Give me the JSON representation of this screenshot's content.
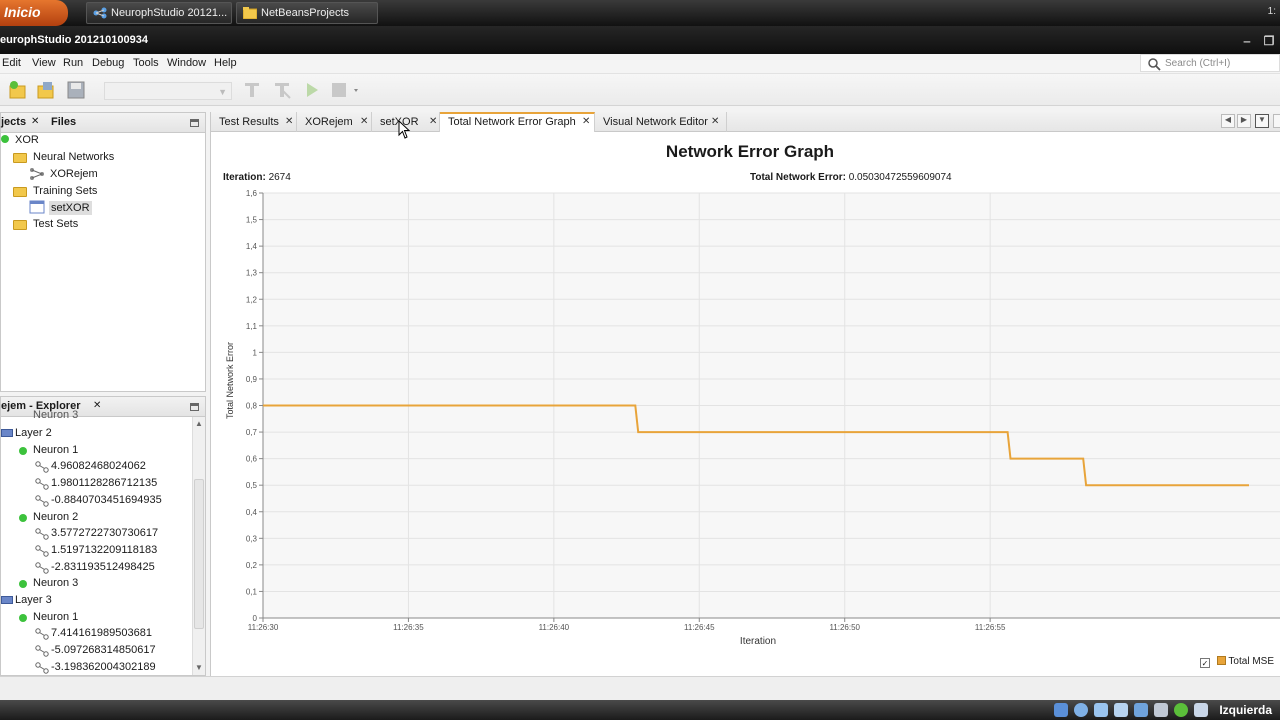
{
  "taskbar": {
    "start": "Inicio",
    "items": [
      "NeurophStudio 20121...",
      "NetBeansProjects"
    ],
    "tray_time": "1:"
  },
  "window": {
    "title": "europhStudio 201210100934",
    "min": "‒",
    "max": "❐"
  },
  "menu": [
    "Edit",
    "View",
    "Run",
    "Debug",
    "Tools",
    "Window",
    "Help"
  ],
  "search": {
    "placeholder": "Search (Ctrl+I)"
  },
  "project_panel": {
    "tabs": [
      "jects",
      "Files"
    ],
    "tree": {
      "root": "XOR",
      "neural_networks": "Neural Networks",
      "network": "XORejem",
      "training_sets": "Training Sets",
      "training_set": "setXOR",
      "test_sets": "Test Sets"
    }
  },
  "explorer_panel": {
    "tab": "ejem - Explorer",
    "cut_top": "Neuron 3",
    "rows": [
      {
        "kind": "layer",
        "label": "Layer 2"
      },
      {
        "kind": "neuron",
        "label": "Neuron 1"
      },
      {
        "kind": "conn",
        "label": "4.96082468024062"
      },
      {
        "kind": "conn",
        "label": "1.9801128286712135"
      },
      {
        "kind": "conn",
        "label": "-0.8840703451694935"
      },
      {
        "kind": "neuron",
        "label": "Neuron 2"
      },
      {
        "kind": "conn",
        "label": "3.5772722730730617"
      },
      {
        "kind": "conn",
        "label": "1.5197132209118183"
      },
      {
        "kind": "conn",
        "label": "-2.831193512498425"
      },
      {
        "kind": "neuron",
        "label": "Neuron 3"
      },
      {
        "kind": "layer",
        "label": "Layer 3"
      },
      {
        "kind": "neuron",
        "label": "Neuron 1"
      },
      {
        "kind": "conn",
        "label": "7.414161989503681"
      },
      {
        "kind": "conn",
        "label": "-5.097268314850617"
      },
      {
        "kind": "conn",
        "label": "-3.198362004302189"
      }
    ]
  },
  "editor_tabs": [
    "Test Results",
    "XORejem",
    "setXOR",
    "Total Network Error Graph",
    "Visual Network Editor"
  ],
  "active_tab": "Total Network Error Graph",
  "graph": {
    "iteration_label": "Iteration:",
    "iteration_value": "2674",
    "error_label": "Total Network Error:",
    "error_value": "0.05030472559609074"
  },
  "chart_data": {
    "type": "line",
    "title": "Network Error Graph",
    "xlabel": "Iteration",
    "ylabel": "Total Network Error",
    "x_ticks": [
      "11:26:30",
      "11:26:35",
      "11:26:40",
      "11:26:45",
      "11:26:50",
      "11:26:55"
    ],
    "y_ticks": [
      "0",
      "0,1",
      "0,2",
      "0,3",
      "0,4",
      "0,5",
      "0,6",
      "0,7",
      "0,8",
      "0,9",
      "1",
      "1,1",
      "1,2",
      "1,3",
      "1,4",
      "1,5",
      "1,6"
    ],
    "xlim": [
      30.0,
      65.0
    ],
    "ylim": [
      0,
      1.6
    ],
    "series": [
      {
        "name": "Total MSE",
        "color": "#e8a43a",
        "points": [
          [
            30.0,
            0.8
          ],
          [
            42.8,
            0.8
          ],
          [
            42.9,
            0.7
          ],
          [
            55.6,
            0.7
          ],
          [
            55.7,
            0.6
          ],
          [
            58.2,
            0.6
          ],
          [
            58.3,
            0.5
          ],
          [
            63.9,
            0.5
          ]
        ]
      }
    ],
    "grid": true,
    "legend": "bottom-right"
  }
}
